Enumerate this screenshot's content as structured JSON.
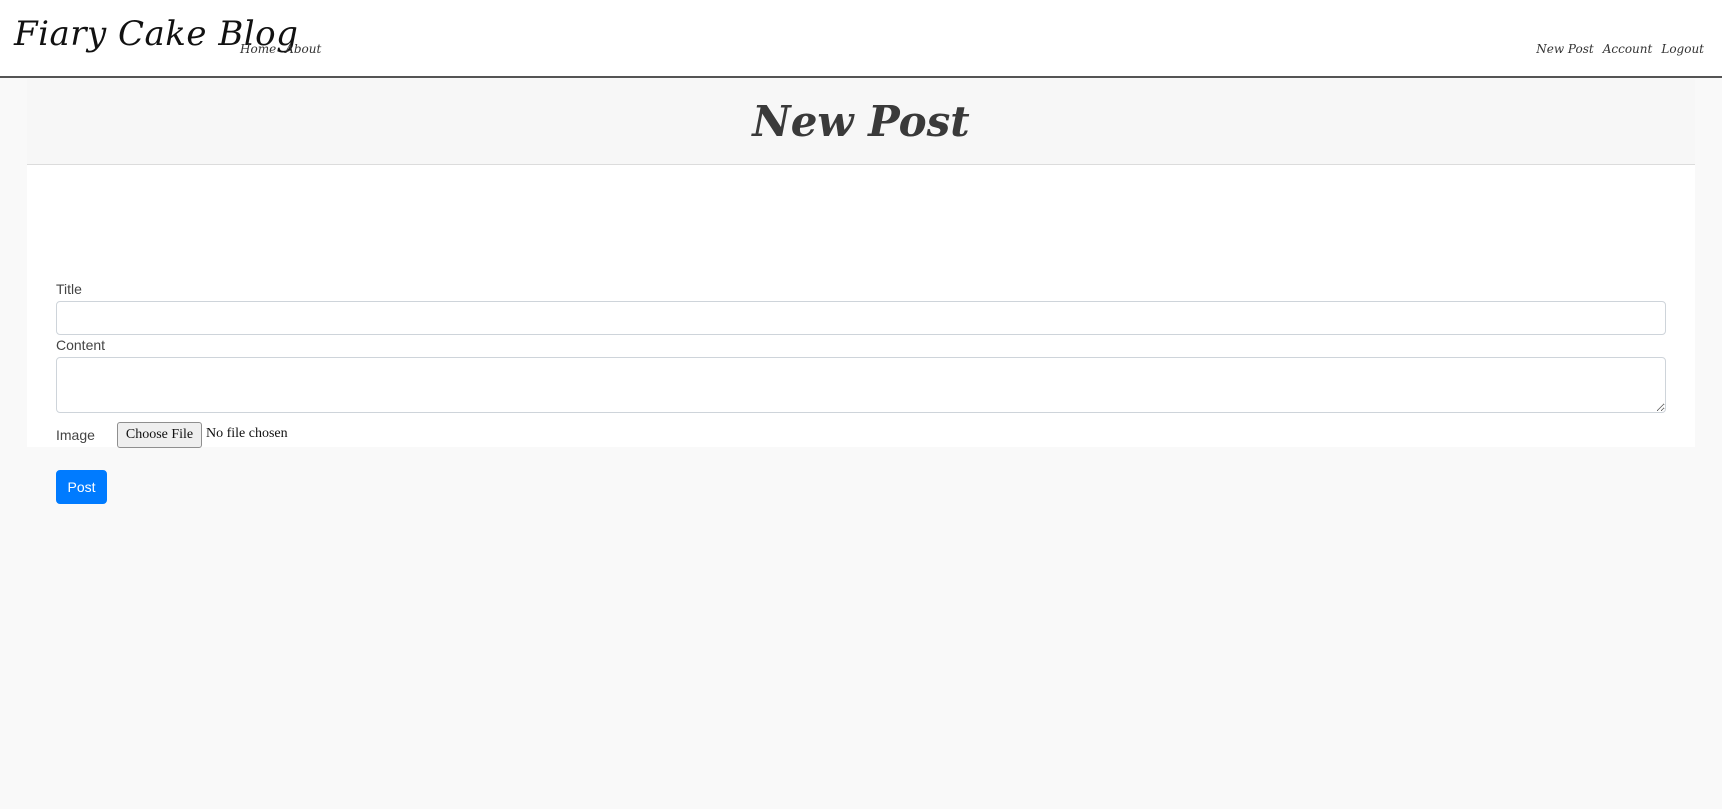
{
  "navbar": {
    "brand": "Fiary Cake Blog",
    "left_links": [
      "Home",
      "About"
    ],
    "right_links": [
      "New Post",
      "Account",
      "Logout"
    ]
  },
  "page": {
    "title": "New Post"
  },
  "form": {
    "title_label": "Title",
    "title_value": "",
    "content_label": "Content",
    "content_value": "",
    "image_label": "Image",
    "file_button_label": "Choose File",
    "file_status": "No file chosen",
    "submit_label": "Post"
  },
  "colors": {
    "primary_button": "#007bff",
    "page_background": "#f9f9f9",
    "header_background": "#f7f7f7"
  }
}
